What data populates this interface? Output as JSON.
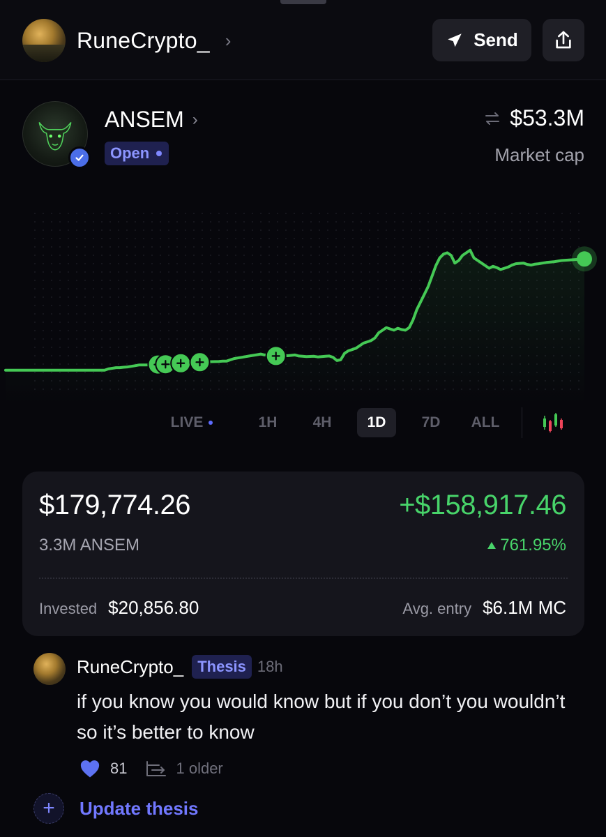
{
  "header": {
    "username": "RuneCrypto_",
    "send_label": "Send",
    "icons": [
      "chevron-right-icon",
      "send-icon",
      "share-icon"
    ]
  },
  "token": {
    "name": "ANSEM",
    "status": "Open",
    "market_cap_value": "$53.3M",
    "market_cap_label": "Market cap",
    "icons": [
      "bull-icon",
      "verified-icon",
      "swap-arrows-icon"
    ]
  },
  "chart_data": {
    "type": "line",
    "title": "",
    "xlabel": "",
    "ylabel": "",
    "grid": true,
    "colors": {
      "line": "#45c955",
      "background": "#07070c"
    },
    "series": [
      {
        "values": [
          5,
          5,
          5,
          5,
          5,
          5,
          5,
          5,
          5,
          5,
          5,
          5,
          5,
          5,
          5,
          5,
          5,
          5,
          5,
          5,
          5,
          5,
          5,
          5,
          5,
          5,
          5,
          6,
          6.5,
          7,
          7,
          7.3,
          7.5,
          8,
          8.5,
          9,
          9,
          9.1,
          9.2,
          9.3,
          9.4,
          9.5,
          9.6,
          9.8,
          10,
          10.2,
          10.4,
          10.6,
          10.8,
          11,
          11,
          11.2,
          11.3,
          11.5,
          11.6,
          11.7,
          11.8,
          12,
          12,
          13,
          14,
          14.5,
          15,
          15.5,
          16,
          16.5,
          17,
          17.5,
          16.8,
          16.8,
          16.5,
          16,
          16.5,
          16.7,
          16.2,
          16.5,
          16.8,
          16,
          15.8,
          15.5,
          15.7,
          15.8,
          15.3,
          15.5,
          15.8,
          16,
          15,
          12.5,
          13,
          18,
          20,
          21,
          22,
          24,
          26,
          27,
          28,
          30,
          34,
          36,
          38,
          37,
          36,
          37.5,
          36.5,
          36,
          38,
          44,
          52,
          58,
          64,
          70,
          78,
          86,
          92,
          95,
          96,
          94,
          88,
          90,
          94,
          96,
          98,
          92,
          90,
          88,
          86,
          84,
          85.5,
          84.5,
          83,
          84,
          85,
          86.5,
          87.5,
          87.8,
          88,
          87,
          86.5,
          87.2,
          87.5,
          88,
          88.5,
          88.8,
          89,
          89.5,
          90,
          90.2,
          90.4,
          90.6,
          90.8,
          91,
          91.2
        ]
      }
    ],
    "trade_markers": [
      40,
      42,
      46,
      51,
      71
    ]
  },
  "time_tabs": [
    "LIVE",
    "1H",
    "4H",
    "1D",
    "7D",
    "ALL"
  ],
  "active_tab": "1D",
  "position": {
    "value": "$179,774.26",
    "pnl": "+$158,917.46",
    "holdings": "3.3M ANSEM",
    "pnl_percent": "761.95%",
    "invested_label": "Invested",
    "invested_value": "$20,856.80",
    "entry_label": "Avg. entry",
    "entry_value": "$6.1M MC"
  },
  "thesis": {
    "author": "RuneCrypto_",
    "tag": "Thesis",
    "time": "18h",
    "text": "if you know you would know but if you don’t you wouldn’t so it’s better to know",
    "likes": "81",
    "older": "1 older",
    "update_label": "Update thesis",
    "icons": [
      "heart-icon",
      "history-icon",
      "plus-icon"
    ]
  },
  "colors": {
    "accent": "#7178ff",
    "positive": "#48d46a",
    "chart_line": "#45c955"
  }
}
